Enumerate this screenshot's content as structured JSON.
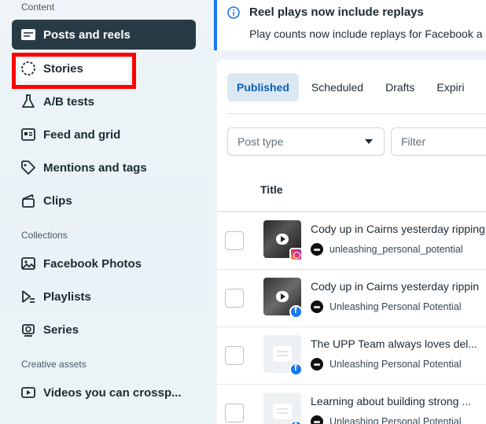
{
  "sidebar": {
    "content_label": "Content",
    "collections_label": "Collections",
    "creative_assets_label": "Creative assets",
    "items": [
      {
        "label": "Posts and reels",
        "icon": "posts-icon",
        "active": true
      },
      {
        "label": "Stories",
        "icon": "stories-icon",
        "active": false
      },
      {
        "label": "A/B tests",
        "icon": "flask-icon",
        "active": false
      },
      {
        "label": "Feed and grid",
        "icon": "feed-icon",
        "active": false
      },
      {
        "label": "Mentions and tags",
        "icon": "tag-icon",
        "active": false
      },
      {
        "label": "Clips",
        "icon": "clapper-icon",
        "active": false
      },
      {
        "label": "Facebook Photos",
        "icon": "photo-icon",
        "active": false
      },
      {
        "label": "Playlists",
        "icon": "playlist-icon",
        "active": false
      },
      {
        "label": "Series",
        "icon": "series-icon",
        "active": false
      },
      {
        "label": "Videos you can crossp...",
        "icon": "video-icon",
        "active": false
      }
    ]
  },
  "banner": {
    "title": "Reel plays now include replays",
    "text": "Play counts now include replays for Facebook a"
  },
  "tabs": [
    "Published",
    "Scheduled",
    "Drafts",
    "Expiri"
  ],
  "filters": {
    "post_type_placeholder": "Post type",
    "filter_placeholder": "Filter"
  },
  "table": {
    "title_header": "Title",
    "rows": [
      {
        "title": "Cody up in Cairns yesterday ripping",
        "account": "unleashing_personal_potential",
        "platform": "instagram"
      },
      {
        "title": "Cody up in Cairns yesterday rippin",
        "account": "Unleashing Personal Potential",
        "platform": "facebook"
      },
      {
        "title": "The UPP Team always loves del...",
        "account": "Unleashing Personal Potential",
        "platform": "facebook"
      },
      {
        "title": "Learning about building strong ...",
        "account": "Unleashing Personal Potential",
        "platform": "facebook"
      }
    ]
  },
  "colors": {
    "accent": "#1877f2",
    "active_nav": "#283a44",
    "highlight": "#ff0000"
  }
}
